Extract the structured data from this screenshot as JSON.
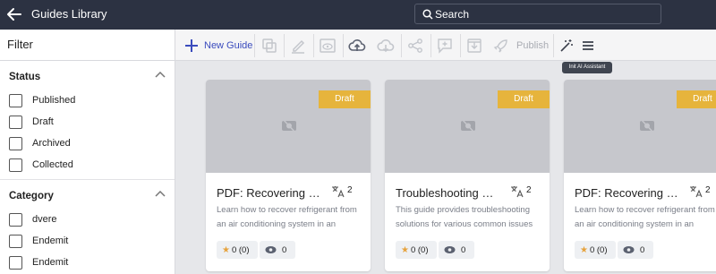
{
  "header": {
    "title": "Guides Library",
    "search_placeholder": "Search"
  },
  "sidebar": {
    "filter_label": "Filter",
    "status": {
      "title": "Status",
      "options": [
        "Published",
        "Draft",
        "Archived",
        "Collected"
      ]
    },
    "category": {
      "title": "Category",
      "options": [
        "dvere",
        "Endemit",
        "Endemit"
      ]
    }
  },
  "toolbar": {
    "new_guide_label": "New Guide",
    "publish_label": "Publish",
    "tooltip": "Init AI Assistant"
  },
  "cards": [
    {
      "badge": "Draft",
      "title": "PDF: Recovering Refrigerant",
      "lang_count": "2",
      "description": "Learn how to recover refrigerant from an air conditioning system in an",
      "rating": "0 (0)",
      "views": "0"
    },
    {
      "badge": "Draft",
      "title": "Troubleshooting Guide",
      "lang_count": "2",
      "description": "This guide provides troubleshooting solutions for various common issues",
      "rating": "0 (0)",
      "views": "0"
    },
    {
      "badge": "Draft",
      "title": "PDF: Recovering Refrigerant",
      "lang_count": "2",
      "description": "Learn how to recover refrigerant from an air conditioning system in an",
      "rating": "0 (0)",
      "views": "0"
    }
  ],
  "colors": {
    "header_bg": "#2c3242",
    "accent": "#3a4bbd",
    "draft_badge": "#e6b43c",
    "thumb_bg": "#c6c7cc"
  }
}
